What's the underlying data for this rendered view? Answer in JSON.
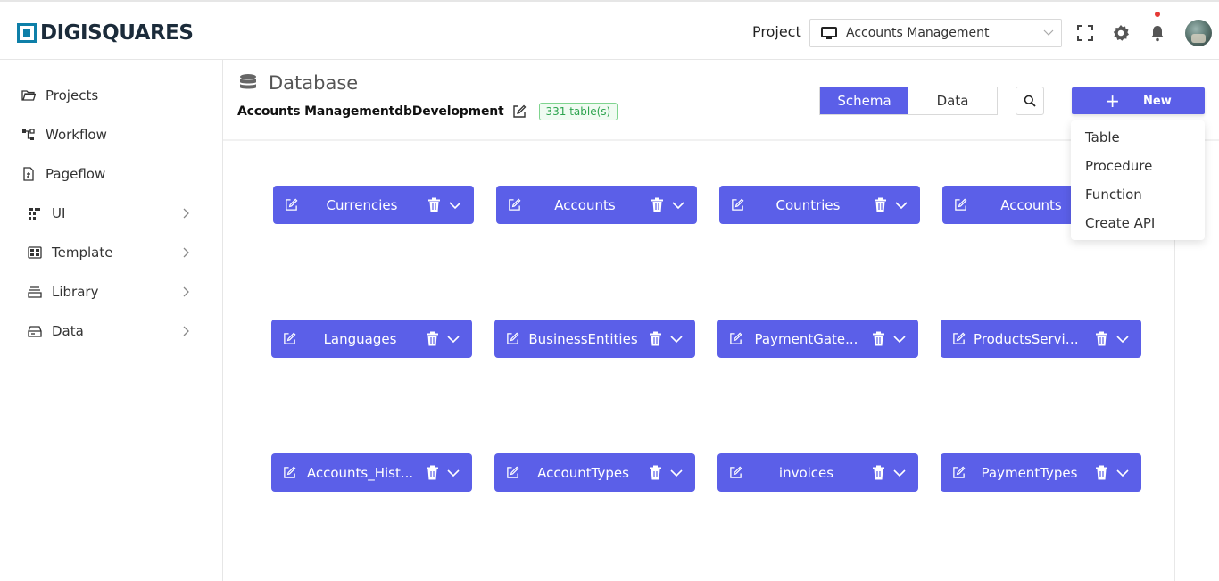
{
  "header": {
    "logo_text": "DIGISQUARES",
    "project_label": "Project",
    "project_value": "Accounts Management"
  },
  "sidebar": {
    "items": [
      {
        "label": "Projects",
        "icon": "folder-open-icon"
      },
      {
        "label": "Workflow",
        "icon": "workflow-icon"
      },
      {
        "label": "Pageflow",
        "icon": "pageflow-icon"
      },
      {
        "label": "UI",
        "icon": "ui-grid-icon"
      },
      {
        "label": "Template",
        "icon": "template-icon"
      },
      {
        "label": "Library",
        "icon": "library-icon"
      },
      {
        "label": "Data",
        "icon": "database-box-icon"
      }
    ]
  },
  "main": {
    "title": "Database",
    "db_name": "Accounts ManagementdbDevelopment",
    "table_count": "331 table(s)",
    "tabs": [
      "Schema",
      "Data"
    ],
    "active_tab": "Schema",
    "new_label": "New",
    "new_menu": [
      "Table",
      "Procedure",
      "Function",
      "Create API"
    ]
  },
  "tables": [
    "Currencies",
    "Accounts",
    "Countries",
    "Accounts",
    "Languages",
    "BusinessEntities",
    "PaymentGate...",
    "ProductsServic...",
    "Accounts_Hist...",
    "AccountTypes",
    "invoices",
    "PaymentTypes"
  ],
  "colors": {
    "accent": "#5b5fe8",
    "badge_green": "#2ea44f",
    "logo_blue": "#0e7fa8"
  }
}
